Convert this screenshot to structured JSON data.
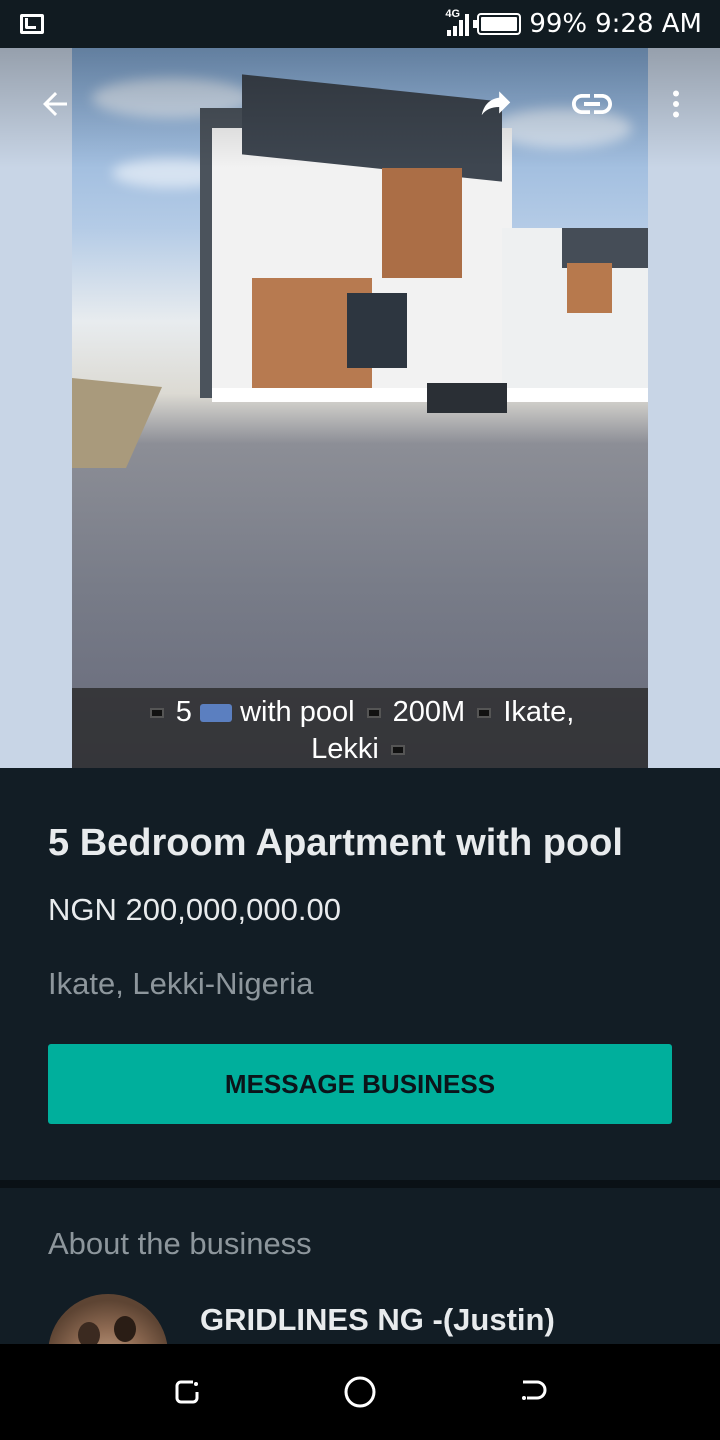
{
  "status_bar": {
    "network": "4G",
    "battery": "99%",
    "time": "9:28 AM"
  },
  "toolbar": {
    "back": "back-icon",
    "share": "share-icon",
    "link": "link-icon",
    "more": "more-vert-icon"
  },
  "hero": {
    "caption_line1_a": "5",
    "caption_line1_b": "with pool",
    "caption_line1_c": "200M",
    "caption_line1_d": "Ikate,",
    "caption_line2": "Lekki"
  },
  "product": {
    "title": "5 Bedroom Apartment with pool",
    "price": "NGN 200,000,000.00",
    "location": "Ikate, Lekki-Nigeria",
    "message_button": "MESSAGE BUSINESS"
  },
  "about": {
    "heading": "About the business",
    "business_name": "GRIDLINES NG -(Justin)"
  },
  "colors": {
    "accent": "#00af9c",
    "background": "#121d25",
    "text_primary": "#e8ebed",
    "text_secondary": "#8d969c"
  }
}
